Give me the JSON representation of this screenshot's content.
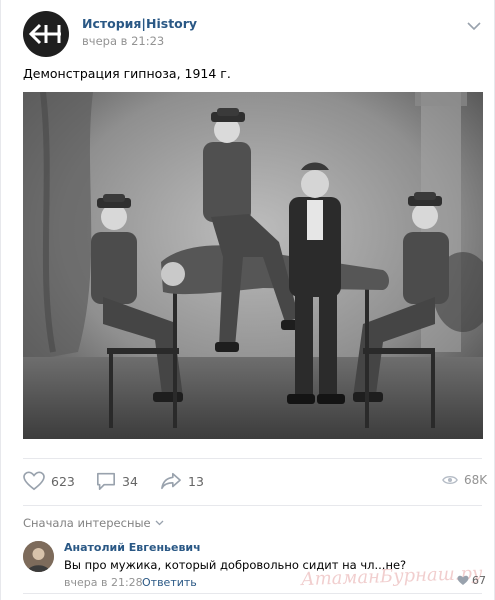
{
  "post": {
    "group_name": "История|History",
    "time": "вчера в 21:23",
    "text": "Демонстрация гипноза, 1914 г.",
    "avatar_icon": "back-arrow-h-logo",
    "more_icon": "chevron-down-icon"
  },
  "actions": {
    "likes": "623",
    "comments": "34",
    "shares": "13",
    "views": "68K"
  },
  "comments": {
    "sort_label": "Сначала интересные",
    "items": [
      {
        "author": "Анатолий Евгеньевич",
        "text": "Вы про мужика, который добровольно сидит на чл...не?",
        "time": "вчера в 21:28",
        "reply_label": "Ответить",
        "likes": "67"
      }
    ]
  },
  "watermark": "АтаманБурнаш.ру"
}
